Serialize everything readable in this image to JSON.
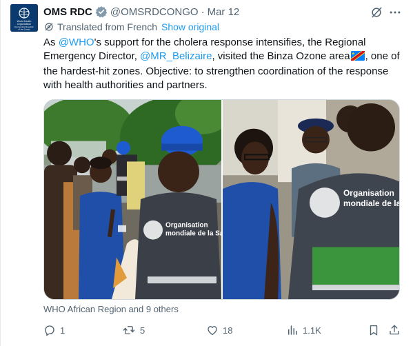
{
  "author": {
    "name": "OMS RDC",
    "handle": "@OMSRDCONGO",
    "date": "Mar 12",
    "avatar_lines": [
      "World Health",
      "Organization",
      "Democratic Republic",
      "of the Congo"
    ]
  },
  "translation": {
    "notice": "Translated from French",
    "show_original": "Show original"
  },
  "tweet": {
    "t1": "As ",
    "m1": "@WHO",
    "t2": "'s support for the cholera response intensifies, the Regional Emergency Director, ",
    "m2": "@MR_Belizaire",
    "t3": ", visited the Binza Ozone area",
    "t4": ", one of the hardest-hit zones. Objective: to strengthen coordination of the response with health authorities and partners."
  },
  "media": {
    "vest_text_left_1": "Organisation",
    "vest_text_left_2": "mondiale de la Santé",
    "vest_text_right_1": "Organisation",
    "vest_text_right_2": "mondiale de la"
  },
  "tagged": "WHO African Region and 9 others",
  "actions": {
    "replies": "1",
    "reposts": "5",
    "likes": "18",
    "views": "1.1K"
  },
  "colors": {
    "accent": "#1d9bf0",
    "muted": "#536471",
    "verified": "#829aab",
    "who_blue": "#0b3a6e"
  },
  "icons": [
    "who-logo-icon",
    "verified-icon",
    "grok-icon",
    "more-icon",
    "translate-gear-icon",
    "drc-flag-icon",
    "reply-icon",
    "repost-icon",
    "like-icon",
    "views-icon",
    "bookmark-icon",
    "share-icon"
  ]
}
